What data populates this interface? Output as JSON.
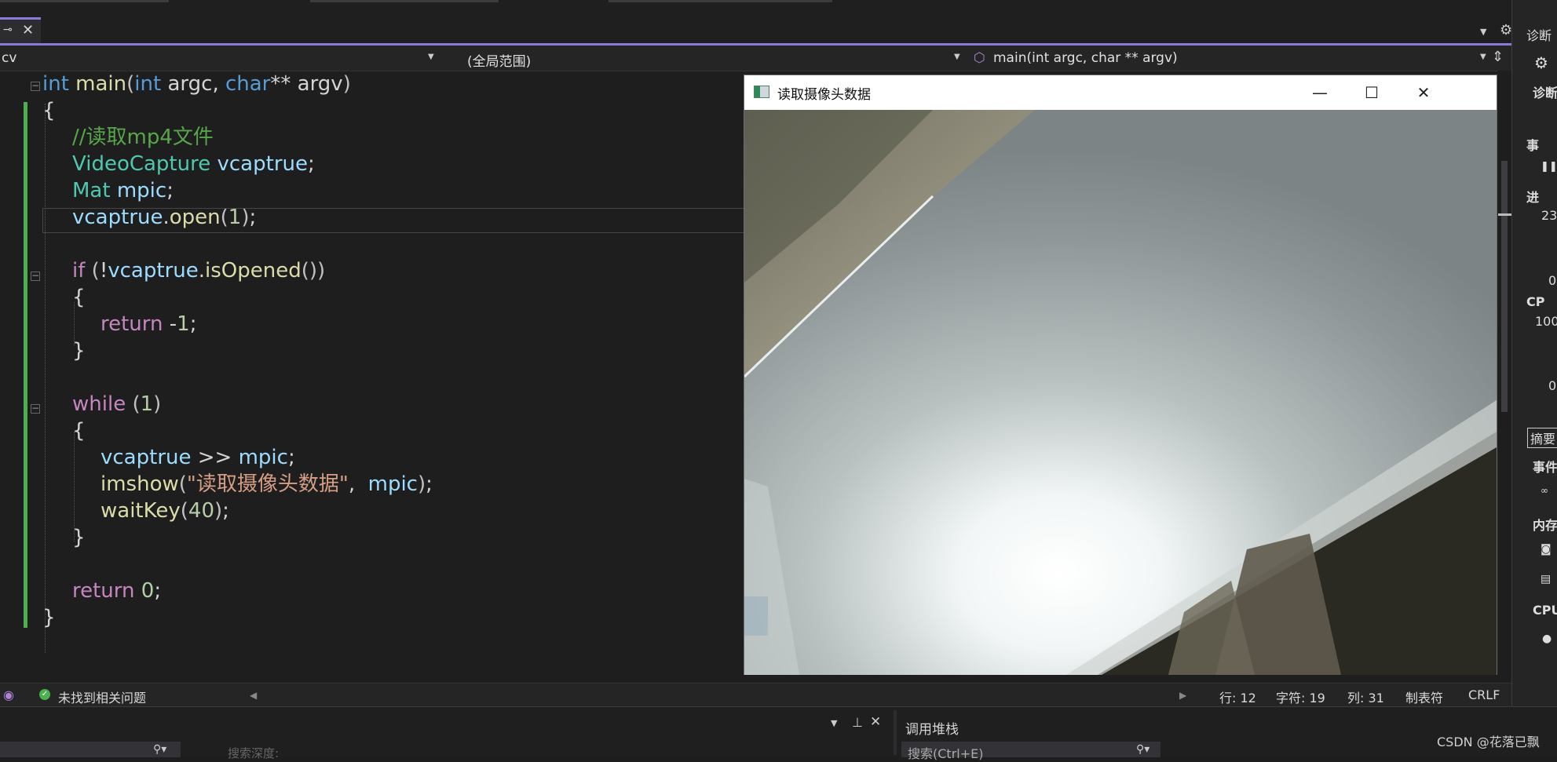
{
  "tabs": {
    "pin_glyph": "⊸",
    "close_glyph": "✕"
  },
  "nav": {
    "project": "cv",
    "scope": "(全局范围)",
    "member": "main(int argc, char ** argv)"
  },
  "code": {
    "comment": "//读取mp4文件",
    "string_literal": "\"读取摄像头数据\""
  },
  "window": {
    "title": "读取摄像头数据",
    "minimize": "—",
    "maximize": "☐",
    "close": "✕"
  },
  "status": {
    "issues": "未找到相关问题",
    "line": "行: 12",
    "char": "字符: 19",
    "col": "列: 31",
    "tabs": "制表符",
    "eol": "CRLF"
  },
  "bottom": {
    "callstack_title": "调用堆栈",
    "search_placeholder": "搜索(Ctrl+E)",
    "depth_label": "搜索深度:",
    "watermark": "CSDN @花落已飘"
  },
  "diagnostics": {
    "title": "诊断",
    "session": "诊断",
    "events": "事",
    "process": "进",
    "process_value": "23",
    "zero1": "0",
    "cpu_short": "CP",
    "cpu_value": "100",
    "zero2": "0",
    "summary_tab": "摘要",
    "events_label": "事件",
    "memory_label": "内存",
    "cpu_label": "CPU"
  }
}
